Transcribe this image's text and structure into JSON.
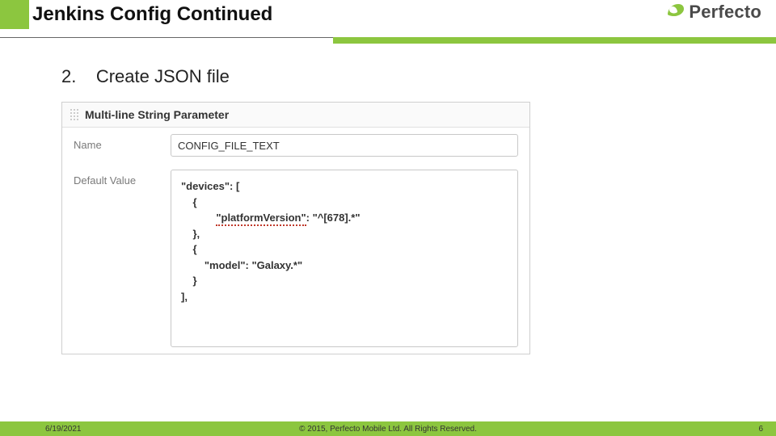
{
  "header": {
    "title": "Jenkins Config Continued",
    "logo_word": "Perfecto"
  },
  "step": {
    "number": "2.",
    "text": "Create JSON file"
  },
  "panel": {
    "heading": "Multi-line String Parameter",
    "name_label": "Name",
    "name_value": "CONFIG_FILE_TEXT",
    "default_label": "Default Value",
    "code": {
      "l1": "\"devices\": [",
      "l2": "    {",
      "l3_indent": "            ",
      "l3_key": "\"platformVersion\"",
      "l3_rest": ": \"^[678].*\"",
      "l4": "    },",
      "l5": "    {",
      "l6": "        \"model\": \"Galaxy.*\"",
      "l7": "    }",
      "l8": "",
      "l9": "],"
    }
  },
  "footer": {
    "date": "6/19/2021",
    "copyright": "© 2015, Perfecto Mobile Ltd.  All Rights Reserved.",
    "page": "6"
  }
}
